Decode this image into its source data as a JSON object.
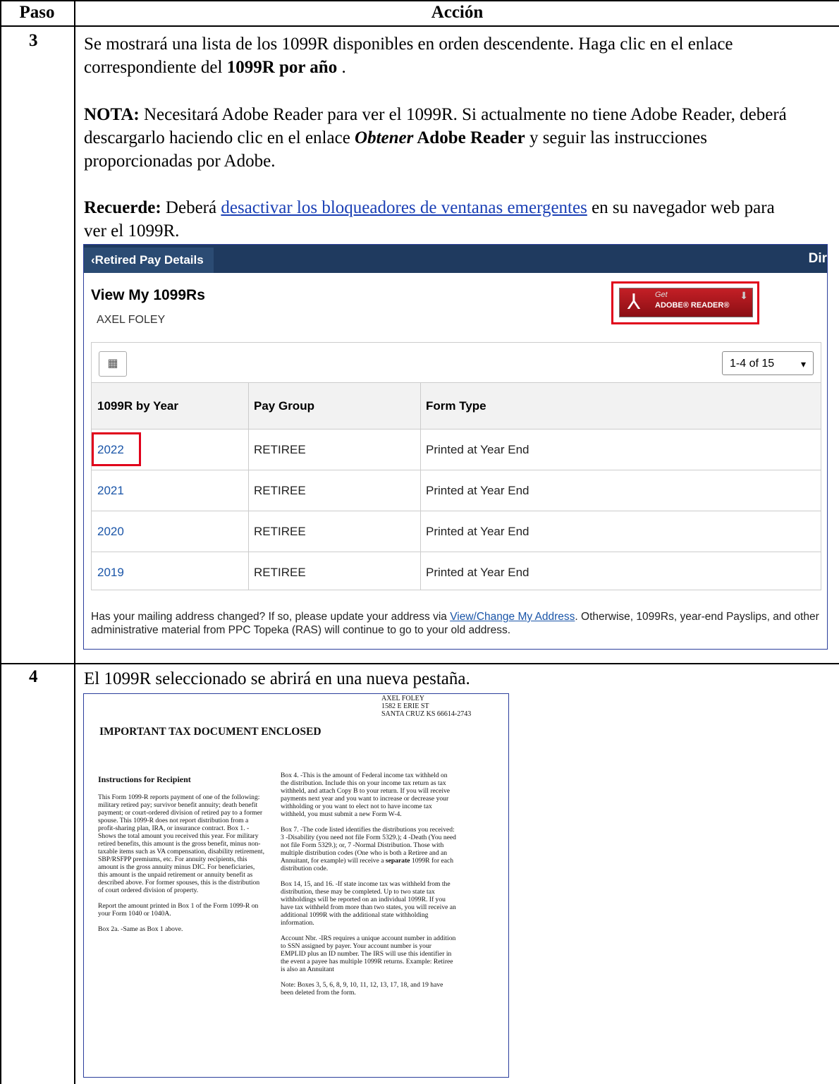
{
  "header": {
    "col_step": "Paso",
    "col_action": "Acción"
  },
  "steps": [
    {
      "number": "3",
      "para1_a": "Se mostrará una lista de los 1099R disponibles en orden descendente.  Haga clic en el enlace correspondiente del ",
      "para1_b": "1099R por año",
      "para1_c": " .",
      "note_label": "NOTA:",
      "note_a": " Necesitará Adobe Reader para ver el 1099R.  Si actualmente no tiene Adobe Reader, deberá descargarlo haciendo clic en el  enlace ",
      "note_b": "Obtener",
      "note_c": " Adobe Reader",
      "note_d": " y seguir las instrucciones proporcionadas por Adobe.",
      "remember_label": "Recuerde:",
      "remember_a": "  Deberá ",
      "remember_link": "desactivar los bloqueadores de ventanas emergentes",
      "remember_b": " en su navegador web para ver el 1099R."
    },
    {
      "number": "4",
      "text": "El 1099R seleccionado se abrirá en una nueva pestaña."
    }
  ],
  "ui": {
    "tab_label": "Retired Pay Details",
    "tab_icon": "chevron-left-icon",
    "right_label": "Dir",
    "title": "View My 1099Rs",
    "user": "AXEL FOLEY",
    "adobe_get": "Get",
    "adobe_reader": "ADOBE® READER®",
    "pager": "1-4 of 15",
    "columns": [
      "1099R by Year",
      "Pay Group",
      "Form Type"
    ],
    "rows": [
      {
        "year": "2022",
        "group": "RETIREE",
        "form": "Printed at Year End"
      },
      {
        "year": "2021",
        "group": "RETIREE",
        "form": "Printed at Year End"
      },
      {
        "year": "2020",
        "group": "RETIREE",
        "form": "Printed at Year End"
      },
      {
        "year": "2019",
        "group": "RETIREE",
        "form": "Printed at Year End"
      }
    ],
    "footer_a": "Has your mailing address changed? If so, please update your address via ",
    "footer_link": "View/Change My Address",
    "footer_b": ". Otherwise, 1099Rs, year-end Payslips, and other administrative material from PPC Topeka (RAS) will continue to go to your old address.",
    "accent": "#1f3a5f",
    "highlight": "#e0001b"
  },
  "doc": {
    "address": [
      "AXEL FOLEY",
      "1582 E ERIE ST",
      "SANTA CRUZ KS 66614-2743"
    ],
    "heading": "IMPORTANT TAX DOCUMENT ENCLOSED",
    "instructions_title": "Instructions for Recipient",
    "col1": [
      "This Form 1099-R reports payment of one of the following: military retired pay; survivor benefit annuity; death benefit payment; or court-ordered division of retired pay to a former spouse. This 1099-R does not report distribution from a profit-sharing plan, IRA, or insurance contract. Box 1. -Shows the total amount you received this year. For military retired benefits, this amount is the gross benefit, minus non-taxable items such as VA compensation, disability retirement, SBP/RSFPP premiums, etc. For annuity recipients, this amount is the gross annuity minus DIC. For beneficiaries, this amount is the unpaid retirement or annuity benefit as described above. For former spouses, this is the distribution of court ordered division of property.",
      "Report the amount printed in Box 1 of the Form 1099-R on your Form 1040 or 1040A.",
      "Box 2a. -Same as Box 1 above."
    ],
    "col2_p1": "Box 4. -This is the amount of Federal income tax withheld on the distribution. Include this on your income tax return as tax withheld, and attach Copy B to your return. If you will receive payments next year and you want to increase or decrease your withholding or you want to elect not to have income tax withheld, you must submit a new Form W-4.",
    "col2_p2_a": "Box 7. -The code listed identifies the distributions you received: 3 -Disability (you need not file Form 5329.); 4 -Death (You need not file Form 5329.); or, 7 -Normal Distribution. Those with multiple distribution codes (One who is both a Retiree and an Annuitant, for example) will receive a ",
    "col2_p2_b": "separate",
    "col2_p2_c": " 1099R for each distribution code.",
    "col2_p3": "Box 14, 15, and 16. -If state income tax was withheld from the distribution, these may be completed. Up to two state tax withholdings will be reported on an individual 1099R. If you have tax withheld from more than two states, you will receive an additional 1099R with the additional state withholding information.",
    "col2_p4": "Account Nbr. -IRS requires a unique account number in addition to SSN assigned by payer.  Your account number is your EMPLID plus an ID number. The IRS will use this identifier in the event a payee has multiple 1099R returns. Example: Retiree is also an Annuitant",
    "col2_p5": "Note: Boxes 3, 5, 6, 8, 9, 10, 11, 12, 13, 17, 18, and 19 have been deleted from the form."
  }
}
